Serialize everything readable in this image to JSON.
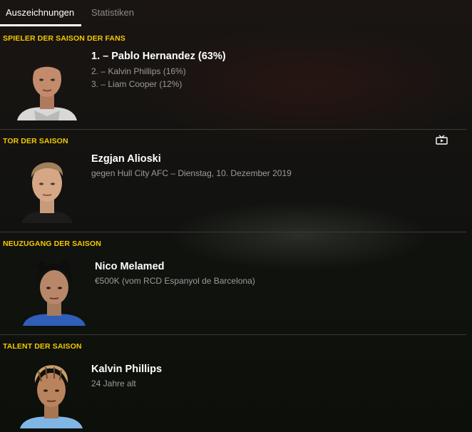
{
  "tabs": [
    {
      "label": "Auszeichnungen",
      "active": true
    },
    {
      "label": "Statistiken",
      "active": false
    }
  ],
  "sections": [
    {
      "title": "SPIELER DER SAISON DER FANS",
      "name": "1. – Pablo Hernandez (63%)",
      "lines": [
        "2. – Kalvin Phillips (16%)",
        "3. – Liam Cooper (12%)"
      ]
    },
    {
      "title": "TOR DER SAISON",
      "name": "Ezgjan Alioski",
      "lines": [
        "gegen Hull City AFC – Dienstag, 10. Dezember 2019"
      ],
      "icon": "tv-video-icon"
    },
    {
      "title": "NEUZUGANG DER SAISON",
      "name": "Nico Melamed",
      "lines": [
        "€500K (vom RCD Espanyol de Barcelona)"
      ]
    },
    {
      "title": "TALENT DER SAISON",
      "name": "Kalvin Phillips",
      "lines": [
        "24 Jahre alt"
      ]
    }
  ],
  "colors": {
    "accent": "#f5c900",
    "text": "#ffffff",
    "muted": "#9b9b9b",
    "divider": "#3a3a36"
  }
}
